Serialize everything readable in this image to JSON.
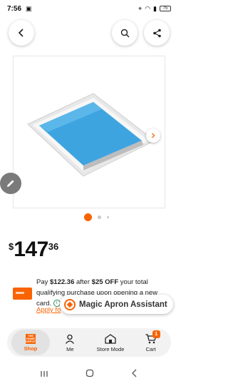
{
  "status_bar": {
    "time": "7:56",
    "battery": "75"
  },
  "product": {
    "price": {
      "currency": "$",
      "dollars": "147",
      "cents": "36"
    },
    "image_icon": "flat-led-panel-light-image",
    "carousel": {
      "total": 3,
      "active": 1
    }
  },
  "promo": {
    "text_pay": "Pay ",
    "discounted_price": "$122.36",
    "text_after": " after ",
    "discount": "$25 OFF",
    "text_rest": " your total qualifying purchase upon opening a new card.",
    "apply_link": "Apply fo"
  },
  "assistant": {
    "label": "Magic Apron Assistant"
  },
  "bottom_nav": {
    "shop": "Shop",
    "me": "Me",
    "store_mode": "Store Mode",
    "cart": "Cart",
    "cart_count": "1"
  },
  "colors": {
    "accent": "#f96302",
    "panel_blue": "#3ea4e0"
  }
}
